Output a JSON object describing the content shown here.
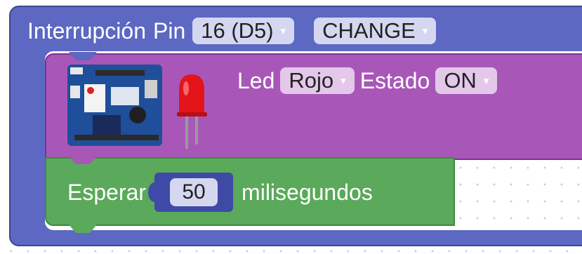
{
  "interrupt_block": {
    "label_interrupt": "Interrupción",
    "label_pin": "Pin",
    "pin_value": "16 (D5)",
    "mode_value": "CHANGE"
  },
  "led_block": {
    "label_led": "Led",
    "color_value": "Rojo",
    "label_state": "Estado",
    "state_value": "ON",
    "icon_board": "arduino-board-icon",
    "icon_led": "red-led-icon"
  },
  "wait_block": {
    "label_wait": "Esperar",
    "number_value": "50",
    "label_unit": "milisegundos"
  },
  "colors": {
    "interrupt": "#5c68c2",
    "led": "#a857b8",
    "wait": "#5ba95a"
  },
  "dropdown_arrow": "▾"
}
